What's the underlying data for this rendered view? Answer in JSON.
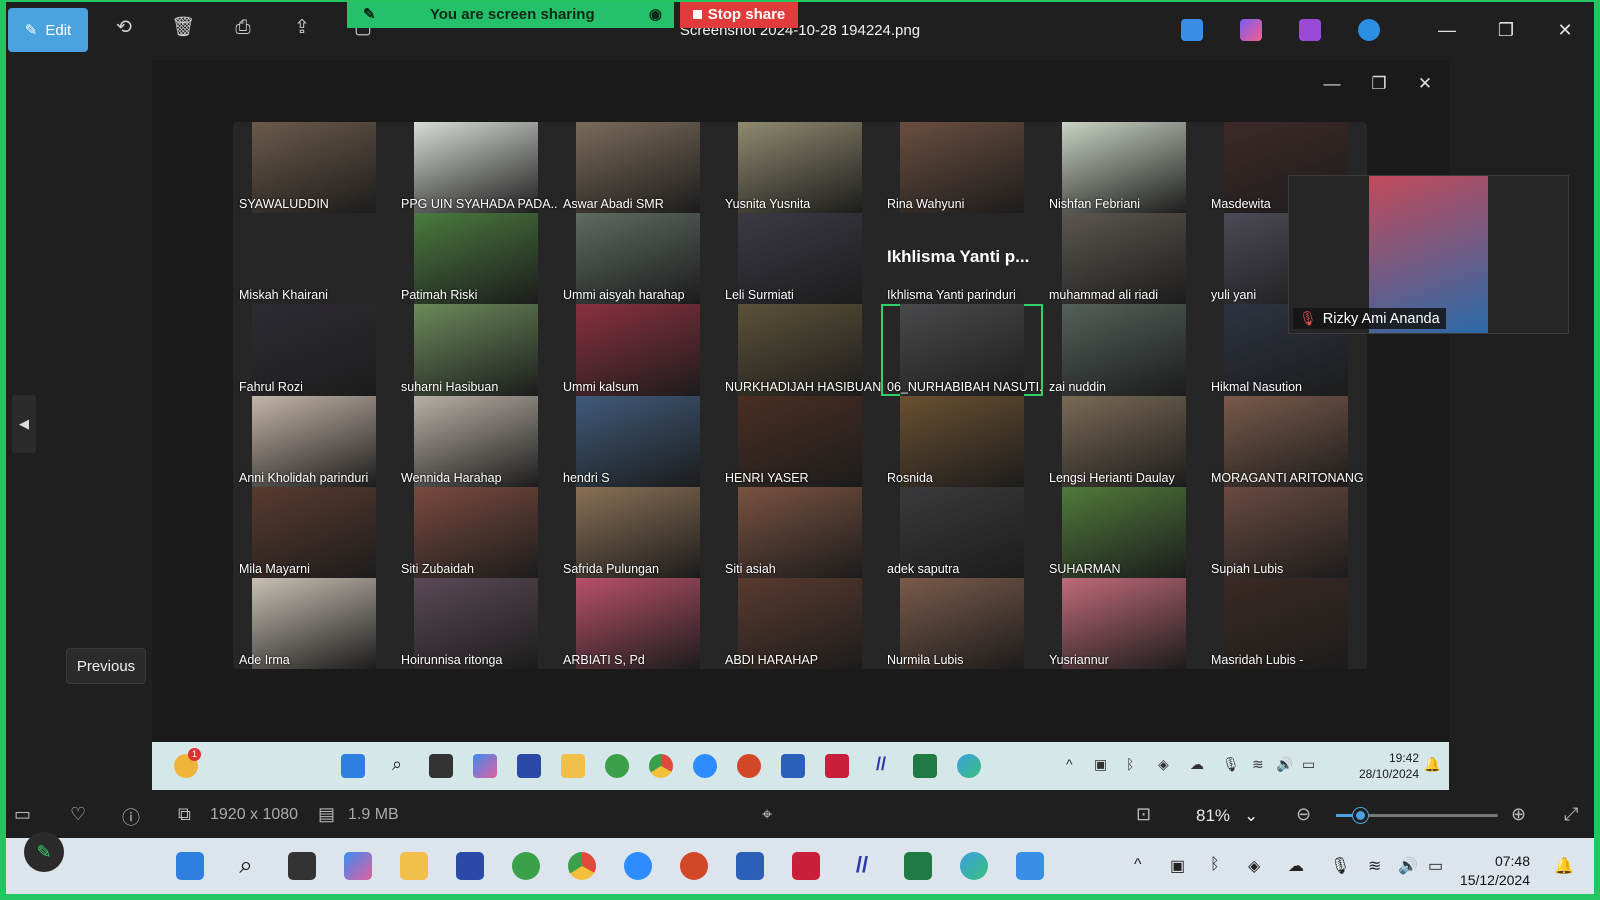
{
  "banner": {
    "sharing_text": "You are screen sharing",
    "stop_label": "Stop share"
  },
  "toolbar": {
    "edit_label": "Edit",
    "file_title": "Screenshot 2024-10-28 194224.png"
  },
  "meeting": {
    "participants": [
      {
        "name": "SYAWALUDDIN",
        "bg": "#6b5a4a"
      },
      {
        "name": "PPG UIN SYAHADA PADA...",
        "bg": "#d8dcd6"
      },
      {
        "name": "Aswar Abadi SMR",
        "bg": "#7a6b5a"
      },
      {
        "name": "Yusnita Yusnita",
        "bg": "#8f8a6f"
      },
      {
        "name": "Rina Wahyuni",
        "bg": "#6a4e3f"
      },
      {
        "name": "Nishfan Febriani",
        "bg": "#c9d2c3"
      },
      {
        "name": "Masdewita",
        "bg": "#3d2a28"
      },
      {
        "name": "Miskah Khairani",
        "bg": ""
      },
      {
        "name": "Patimah Riski",
        "bg": "#4a7a3e"
      },
      {
        "name": "Ummi aisyah harahap",
        "bg": "#5f6a62"
      },
      {
        "name": "Leli Surmiati",
        "bg": "#3b3a44"
      },
      {
        "name": "Ikhlisma Yanti parinduri",
        "bg": "",
        "big_label": "Ikhlisma Yanti p..."
      },
      {
        "name": "muhammad ali riadi",
        "bg": "#5b5650"
      },
      {
        "name": "yuli yani",
        "bg": "#4c4a55"
      },
      {
        "name": "Fahrul Rozi",
        "bg": "#2e2c33"
      },
      {
        "name": "suharni Hasibuan",
        "bg": "#6b8a5a"
      },
      {
        "name": "Ummi kalsum",
        "bg": "#8a3040"
      },
      {
        "name": "NURKHADIJAH HASIBUAN",
        "bg": "#5c5238"
      },
      {
        "name": "06_NURHABIBAH NASUTI...",
        "bg": "#4a4a4c",
        "active": true
      },
      {
        "name": "zai nuddin",
        "bg": "#55605a"
      },
      {
        "name": "Hikmal Nasution",
        "bg": "#2e3340"
      },
      {
        "name": "Anni Kholidah parinduri",
        "bg": "#c4b5a8"
      },
      {
        "name": "Wennida Harahap",
        "bg": "#b8b0a6"
      },
      {
        "name": "hendri S",
        "bg": "#3f5a7a"
      },
      {
        "name": "HENRI YASER",
        "bg": "#4a2e22"
      },
      {
        "name": "Rosnida",
        "bg": "#6a5030"
      },
      {
        "name": "Lengsi Herianti Daulay",
        "bg": "#7a6a55"
      },
      {
        "name": "MORAGANTI ARITONANG",
        "bg": "#7a5a4a"
      },
      {
        "name": "Mila Mayarni",
        "bg": "#5a3a2e"
      },
      {
        "name": "Siti Zubaidah",
        "bg": "#7a4a3e"
      },
      {
        "name": "Safrida Pulungan",
        "bg": "#8a7055"
      },
      {
        "name": "Siti asiah",
        "bg": "#7a5240"
      },
      {
        "name": "adek saputra",
        "bg": "#3a3a3c"
      },
      {
        "name": "SUHARMAN",
        "bg": "#4f7a3a"
      },
      {
        "name": "Supiah Lubis",
        "bg": "#6a4a40"
      },
      {
        "name": "Ade Irma",
        "bg": "#c8c0b4"
      },
      {
        "name": "Hoirunnisa ritonga",
        "bg": "#5a4a55"
      },
      {
        "name": "ARBIATI S, Pd",
        "bg": "#b8506a"
      },
      {
        "name": "ABDI HARAHAP",
        "bg": "#5a3a2e"
      },
      {
        "name": "Nurmila Lubis",
        "bg": "#7a5a4a"
      },
      {
        "name": "Yusriannur",
        "bg": "#c06a7a"
      },
      {
        "name": "Masridah Lubis -",
        "bg": "#3a2a24"
      }
    ],
    "floating_participant": {
      "name": "Rizky Ami Ananda",
      "bg": "#c24a5a",
      "mic": "muted"
    }
  },
  "nav": {
    "previous_label": "Previous"
  },
  "inner_taskbar": {
    "time": "19:42",
    "date": "28/10/2024",
    "weather_badge": "1"
  },
  "info": {
    "dimensions": "1920 x 1080",
    "size": "1.9 MB",
    "zoom": "81%",
    "zoom_fraction": 0.15
  },
  "taskbar": {
    "time": "07:48",
    "date": "15/12/2024"
  },
  "colors": {
    "accent": "#4aa3df",
    "share_green": "#25c06a",
    "stop_red": "#e23b3b",
    "frame_green": "#22c55e"
  }
}
